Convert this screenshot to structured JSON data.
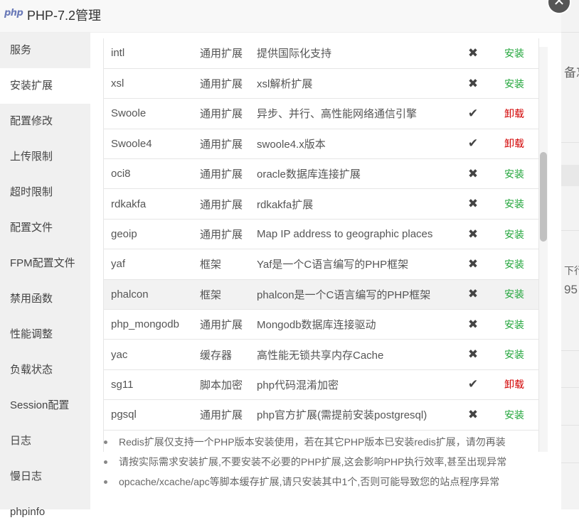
{
  "window": {
    "logo_text": "php",
    "title": "PHP-7.2管理",
    "close_glyph": "✕"
  },
  "background": {
    "text_1": "备忘",
    "text_2": "下行",
    "text_3": "95"
  },
  "sidebar": {
    "items": [
      {
        "label": "服务"
      },
      {
        "label": "安装扩展"
      },
      {
        "label": "配置修改"
      },
      {
        "label": "上传限制"
      },
      {
        "label": "超时限制"
      },
      {
        "label": "配置文件"
      },
      {
        "label": "FPM配置文件"
      },
      {
        "label": "禁用函数"
      },
      {
        "label": "性能调整"
      },
      {
        "label": "负载状态"
      },
      {
        "label": "Session配置"
      },
      {
        "label": "日志"
      },
      {
        "label": "慢日志"
      },
      {
        "label": "phpinfo"
      }
    ],
    "active_index": 1
  },
  "extensions": [
    {
      "name": "intl",
      "type": "通用扩展",
      "desc": "提供国际化支持",
      "installed": false,
      "op": "安装"
    },
    {
      "name": "xsl",
      "type": "通用扩展",
      "desc": "xsl解析扩展",
      "installed": false,
      "op": "安装"
    },
    {
      "name": "Swoole",
      "type": "通用扩展",
      "desc": "异步、并行、高性能网络通信引擎",
      "installed": true,
      "op": "卸载"
    },
    {
      "name": "Swoole4",
      "type": "通用扩展",
      "desc": "swoole4.x版本",
      "installed": true,
      "op": "卸载"
    },
    {
      "name": "oci8",
      "type": "通用扩展",
      "desc": "oracle数据库连接扩展",
      "installed": false,
      "op": "安装"
    },
    {
      "name": "rdkakfa",
      "type": "通用扩展",
      "desc": "rdkakfa扩展",
      "installed": false,
      "op": "安装"
    },
    {
      "name": "geoip",
      "type": "通用扩展",
      "desc": "Map IP address to geographic places",
      "installed": false,
      "op": "安装"
    },
    {
      "name": "yaf",
      "type": "框架",
      "desc": "Yaf是一个C语言编写的PHP框架",
      "installed": false,
      "op": "安装"
    },
    {
      "name": "phalcon",
      "type": "框架",
      "desc": "phalcon是一个C语言编写的PHP框架",
      "installed": false,
      "op": "安装"
    },
    {
      "name": "php_mongodb",
      "type": "通用扩展",
      "desc": "Mongodb数据库连接驱动",
      "installed": false,
      "op": "安装"
    },
    {
      "name": "yac",
      "type": "缓存器",
      "desc": "高性能无锁共享内存Cache",
      "installed": false,
      "op": "安装"
    },
    {
      "name": "sg11",
      "type": "脚本加密",
      "desc": "php代码混淆加密",
      "installed": true,
      "op": "卸载"
    },
    {
      "name": "pgsql",
      "type": "通用扩展",
      "desc": "php官方扩展(需提前安装postgresql)",
      "installed": false,
      "op": "安装"
    }
  ],
  "hover_row_index": 8,
  "status_icons": {
    "installed": "✔",
    "not_installed": "✖"
  },
  "colors": {
    "install": "#20a53a",
    "uninstall": "#d20000"
  },
  "notes": [
    "Redis扩展仅支持一个PHP版本安装使用，若在其它PHP版本已安装redis扩展，请勿再装",
    "请按实际需求安装扩展,不要安装不必要的PHP扩展,这会影响PHP执行效率,甚至出现异常",
    "opcache/xcache/apc等脚本缓存扩展,请只安装其中1个,否则可能导致您的站点程序异常"
  ]
}
